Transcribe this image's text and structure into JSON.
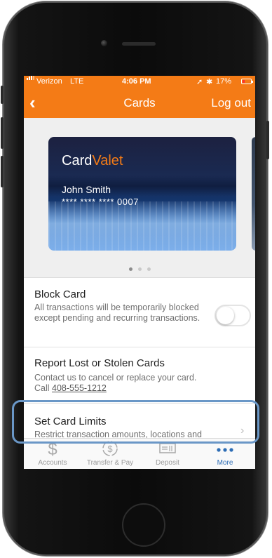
{
  "status_bar": {
    "carrier": "Verizon",
    "network": "LTE",
    "time": "4:06 PM",
    "battery": "17%"
  },
  "nav": {
    "title": "Cards",
    "logout_label": "Log out"
  },
  "card": {
    "brand_prefix": "Card",
    "brand_suffix": "Valet",
    "holder": "John Smith",
    "number": "**** **** **** 0007"
  },
  "carousel": {
    "page_count": 3,
    "active_page": 1
  },
  "block_card": {
    "title": "Block Card",
    "description": "All transactions will be temporarily blocked except pending and recurring transactions.",
    "enabled": false
  },
  "report_lost": {
    "title": "Report Lost or Stolen Cards",
    "description": "Contact us to cancel or replace your card.",
    "call_label": "Call",
    "phone": "408-555-1212"
  },
  "card_limits": {
    "title": "Set Card Limits",
    "description": "Restrict transaction amounts, locations and merchants for this card."
  },
  "tabs": [
    {
      "label": "Accounts",
      "icon": "dollar-icon"
    },
    {
      "label": "Transfer & Pay",
      "icon": "transfer-pay-icon"
    },
    {
      "label": "Deposit",
      "icon": "deposit-check-icon"
    },
    {
      "label": "More",
      "icon": "more-dots-icon",
      "active": true
    }
  ],
  "colors": {
    "brand_orange": "#f47b16",
    "active_tab": "#2d6db5",
    "highlight_outline": "#6a97c7"
  }
}
